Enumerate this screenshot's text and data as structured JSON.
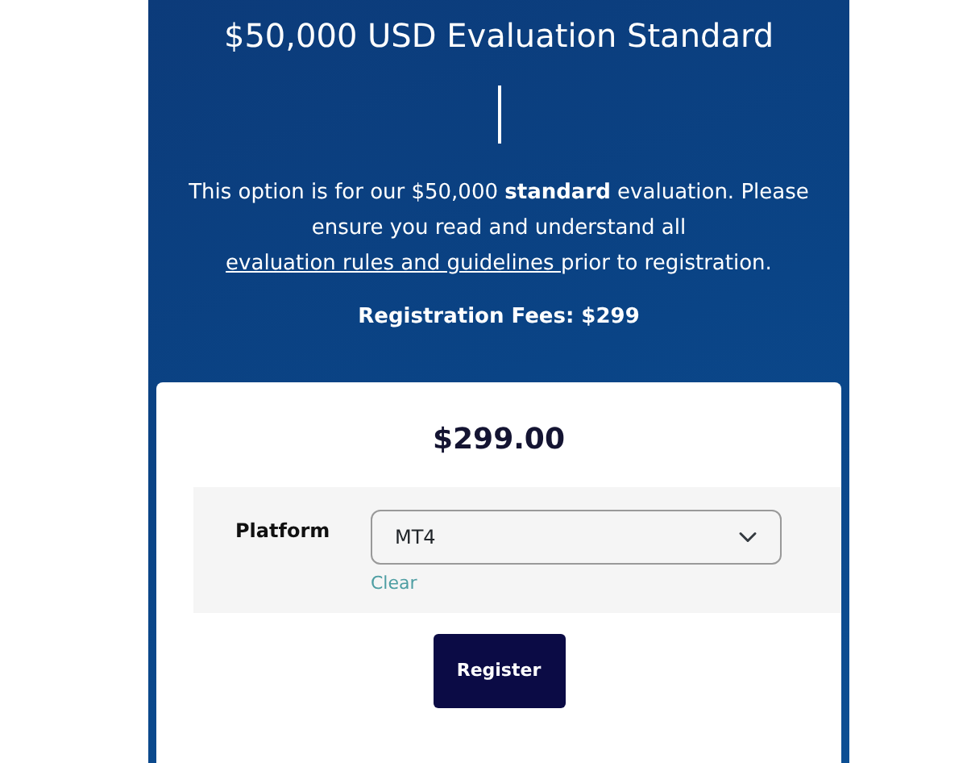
{
  "title": "$50,000 USD Evaluation Standard",
  "intro": {
    "text": "This option is for our $50,000 **standard** evaluation. Please ensure you read and understand all ",
    "link": "evaluation rules and guidelines ",
    "text_after": "prior to registration."
  },
  "fees": "Registration Fees: $299",
  "card": {
    "price": "$299.00",
    "platform_label": "Platform",
    "platform_select": {
      "value": "MT4"
    },
    "clear_link": "Clear",
    "register_button": "Register"
  }
}
